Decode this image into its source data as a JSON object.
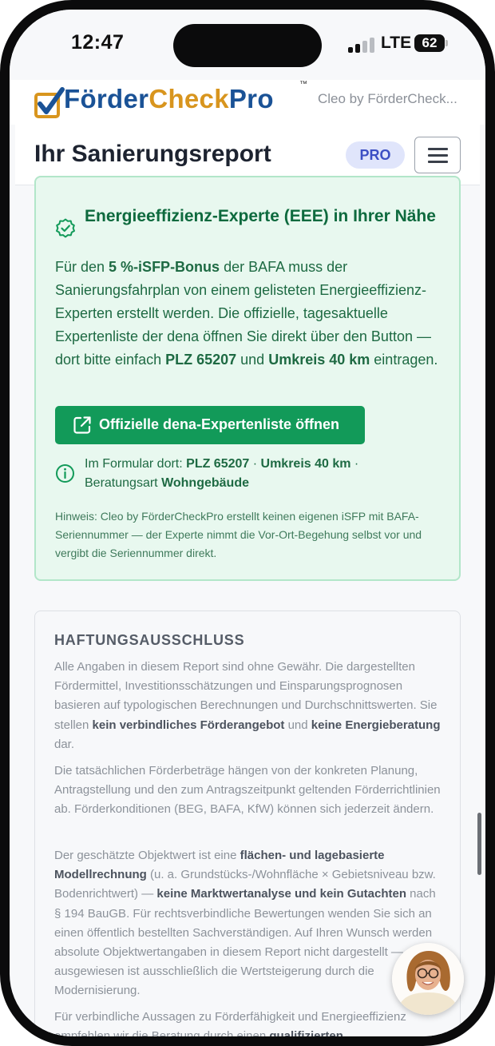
{
  "status_bar": {
    "time": "12:47",
    "network": "LTE",
    "battery": "62"
  },
  "logo": {
    "part1": "Förder",
    "part2": "Check",
    "part3": "Pro",
    "trademark": "™",
    "tagline": "Cleo by FörderCheck..."
  },
  "header": {
    "title": "Ihr Sanierungsreport",
    "badge": "PRO"
  },
  "eee_card": {
    "title": "Energieeffizienz-Experte (EEE) in Ihrer Nähe",
    "body": {
      "t1": "Für den ",
      "b1": "5 %-iSFP-Bonus",
      "t2": " der BAFA muss der Sanierungsfahrplan von einem gelisteten Energieeffizienz-Experten erstellt werden. Die offizielle, tagesaktuelle Expertenliste der dena öffnen Sie direkt über den Button — dort bitte einfach ",
      "b2": "PLZ 65207",
      "t3": " und ",
      "b3": "Umkreis 40 km",
      "t4": " eintragen."
    },
    "button_label": "Offizielle dena-Expertenliste öffnen",
    "info": {
      "t1": "Im Formular dort: ",
      "b1": "PLZ 65207",
      "t2": " · ",
      "b2": "Umkreis 40 km",
      "t3": " · Beratungsart ",
      "b3": "Wohngebäude"
    },
    "hint": "Hinweis: Cleo by FörderCheckPro erstellt keinen eigenen iSFP mit BAFA-Seriennummer — der Experte nimmt die Vor-Ort-Begehung selbst vor und vergibt die Seriennummer direkt."
  },
  "disclaimer": {
    "title": "HAFTUNGSAUSSCHLUSS",
    "p1": {
      "t1": "Alle Angaben in diesem Report sind ohne Gewähr. Die dargestellten Fördermittel, Investitionsschätzungen und Einsparungsprognosen basieren auf typologischen Berechnungen und Durchschnittswerten. Sie stellen ",
      "b1": "kein verbindliches Förderangebot",
      "t2": " und ",
      "b2": "keine Energieberatung",
      "t3": " dar."
    },
    "p2": "Die tatsächlichen Förderbeträge hängen von der konkreten Planung, Antragstellung und den zum Antragszeitpunkt geltenden Förderrichtlinien ab. Förderkonditionen (BEG, BAFA, KfW) können sich jederzeit ändern.",
    "p3": {
      "t1": "Der geschätzte Objektwert ist eine ",
      "b1": "flächen- und lagebasierte Modellrechnung",
      "t2": " (u. a. Grundstücks-/Wohnfläche × Gebietsniveau bzw. Bodenrichtwert) — ",
      "b2": "keine Marktwertanalyse und kein Gutachten",
      "t3": " nach § 194 BauGB. Für rechtsverbindliche Bewertungen wenden Sie sich an einen öffentlich bestellten Sachverständigen. Auf Ihren Wunsch werden absolute Objektwertangaben in diesem Report nicht dargestellt — ausgewiesen ist ausschließlich die Wertsteigerung durch die Modernisierung."
    },
    "p4": {
      "t1": "Für verbindliche Aussagen zu Förderfähigkeit und Energieeffizienz empfehlen wir die Beratung durch einen ",
      "b1": "qualifizierten"
    }
  },
  "icons": {
    "check": "check-badge-icon",
    "external": "external-link-icon",
    "info": "info-icon",
    "menu": "menu-icon"
  },
  "colors": {
    "brand_blue": "#1a5296",
    "brand_gold": "#d8951e",
    "success_green": "#129a59",
    "card_bg": "#e8f8ef",
    "pro_badge_bg": "#e0e5fb"
  }
}
